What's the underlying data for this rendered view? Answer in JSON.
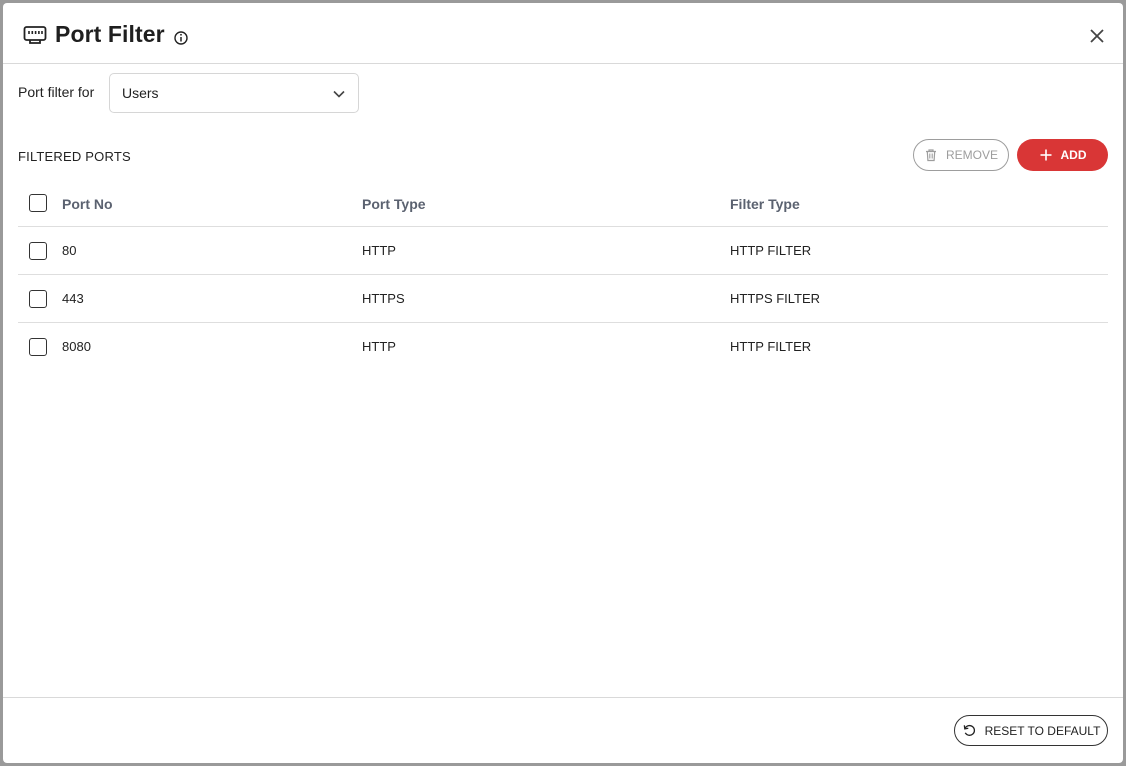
{
  "dialog": {
    "title": "Port Filter",
    "title_icon": "ethernet-port-icon",
    "info_icon": "info-icon",
    "close_icon": "close-icon"
  },
  "filter": {
    "label": "Port filter for",
    "selected": "Users"
  },
  "section": {
    "title": "FILTERED PORTS",
    "remove_label": "REMOVE",
    "add_label": "ADD"
  },
  "table": {
    "columns": [
      "Port No",
      "Port Type",
      "Filter Type"
    ],
    "rows": [
      {
        "port": "80",
        "type": "HTTP",
        "filter": "HTTP FILTER"
      },
      {
        "port": "443",
        "type": "HTTPS",
        "filter": "HTTPS FILTER"
      },
      {
        "port": "8080",
        "type": "HTTP",
        "filter": "HTTP FILTER"
      }
    ]
  },
  "footer": {
    "reset_label": "RESET TO DEFAULT"
  },
  "colors": {
    "accent": "#d93636",
    "border": "#d9d9d9",
    "header_text": "#5b6270"
  }
}
